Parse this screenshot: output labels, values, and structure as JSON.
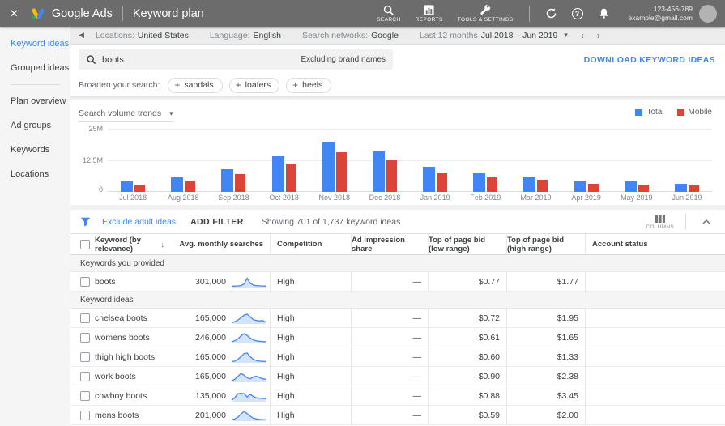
{
  "app_bar": {
    "product": "Google Ads",
    "page_title": "Keyword plan",
    "nav_items": [
      {
        "label": "SEARCH"
      },
      {
        "label": "REPORTS"
      },
      {
        "label": "TOOLS & SETTINGS"
      }
    ],
    "account_id": "123-456-789",
    "account_email": "example@gmail.com"
  },
  "sidebar": {
    "items": [
      {
        "label": "Keyword ideas"
      },
      {
        "label": "Grouped ideas"
      },
      {
        "label": "Plan overview"
      },
      {
        "label": "Ad groups"
      },
      {
        "label": "Keywords"
      },
      {
        "label": "Locations"
      }
    ]
  },
  "toolbar": {
    "filters": [
      {
        "label": "Locations:",
        "value": "United States"
      },
      {
        "label": "Language:",
        "value": "English"
      },
      {
        "label": "Search networks:",
        "value": "Google"
      }
    ],
    "date_label": "Last 12 months",
    "date_range": "Jul 2018 – Jun 2019"
  },
  "search": {
    "query": "boots",
    "brand_filter": "Excluding brand names",
    "download_label": "DOWNLOAD KEYWORD IDEAS"
  },
  "broaden": {
    "label": "Broaden your search:",
    "chips": [
      {
        "label": "sandals"
      },
      {
        "label": "loafers"
      },
      {
        "label": "heels"
      }
    ]
  },
  "chart_data": {
    "type": "bar",
    "title": "Search volume trends",
    "categories": [
      "Jul 2018",
      "Aug 2018",
      "Sep 2018",
      "Oct 2018",
      "Nov 2018",
      "Dec 2018",
      "Jan 2019",
      "Feb 2019",
      "Mar 2019",
      "Apr 2019",
      "May 2019",
      "Jun 2019"
    ],
    "series": [
      {
        "name": "Total",
        "color": "#4285f4",
        "values": [
          4.2,
          5.8,
          9.0,
          14.2,
          20.0,
          16.3,
          10.0,
          7.6,
          6.2,
          4.3,
          4.2,
          3.4
        ]
      },
      {
        "name": "Mobile",
        "color": "#db4437",
        "values": [
          3.0,
          4.4,
          7.0,
          11.0,
          15.8,
          12.7,
          7.7,
          5.8,
          4.8,
          3.1,
          2.8,
          2.6
        ]
      }
    ],
    "values_unit": "millions of searches",
    "ylim": [
      0,
      25
    ],
    "yticks": [
      "25M",
      "12.5M",
      "0"
    ],
    "grid": "horizontal",
    "legend_position": "top-right"
  },
  "filter_bar": {
    "exclude_link": "Exclude adult ideas",
    "add_filter": "ADD FILTER",
    "showing": "Showing 701 of 1,737 keyword ideas",
    "columns_label": "COLUMNS"
  },
  "table": {
    "columns": [
      "Keyword (by relevance)",
      "Avg. monthly searches",
      "Competition",
      "Ad impression share",
      "Top of page bid (low range)",
      "Top of page bid (high range)",
      "Account status"
    ],
    "sections": [
      {
        "label": "Keywords you provided",
        "rows": [
          {
            "keyword": "boots",
            "avg_monthly_searches": "301,000",
            "competition": "High",
            "ad_impression_share": "—",
            "top_bid_low": "$0.77",
            "top_bid_high": "$1.77",
            "account_status": "",
            "spark": [
              0.06,
              0.07,
              0.09,
              0.13,
              0.3,
              0.95,
              0.4,
              0.18,
              0.12,
              0.1,
              0.08,
              0.07
            ]
          }
        ]
      },
      {
        "label": "Keyword ideas",
        "rows": [
          {
            "keyword": "chelsea boots",
            "avg_monthly_searches": "165,000",
            "competition": "High",
            "ad_impression_share": "—",
            "top_bid_low": "$0.72",
            "top_bid_high": "$1.95",
            "account_status": "",
            "spark": [
              0.08,
              0.15,
              0.35,
              0.6,
              0.9,
              1.0,
              0.7,
              0.4,
              0.3,
              0.25,
              0.3,
              0.12
            ]
          },
          {
            "keyword": "womens boots",
            "avg_monthly_searches": "246,000",
            "competition": "High",
            "ad_impression_share": "—",
            "top_bid_low": "$0.61",
            "top_bid_high": "$1.65",
            "account_status": "",
            "spark": [
              0.1,
              0.2,
              0.4,
              0.75,
              1.0,
              0.8,
              0.5,
              0.3,
              0.2,
              0.15,
              0.12,
              0.1
            ]
          },
          {
            "keyword": "thigh high boots",
            "avg_monthly_searches": "165,000",
            "competition": "High",
            "ad_impression_share": "—",
            "top_bid_low": "$0.60",
            "top_bid_high": "$1.33",
            "account_status": "",
            "spark": [
              0.05,
              0.1,
              0.3,
              0.6,
              0.95,
              1.0,
              0.6,
              0.3,
              0.15,
              0.1,
              0.08,
              0.05
            ]
          },
          {
            "keyword": "work boots",
            "avg_monthly_searches": "165,000",
            "competition": "High",
            "ad_impression_share": "—",
            "top_bid_low": "$0.90",
            "top_bid_high": "$2.38",
            "account_status": "",
            "spark": [
              0.1,
              0.25,
              0.55,
              0.9,
              0.7,
              0.4,
              0.3,
              0.5,
              0.6,
              0.45,
              0.3,
              0.25
            ]
          },
          {
            "keyword": "cowboy boots",
            "avg_monthly_searches": "135,000",
            "competition": "High",
            "ad_impression_share": "—",
            "top_bid_low": "$0.88",
            "top_bid_high": "$3.45",
            "account_status": "",
            "spark": [
              0.1,
              0.35,
              0.8,
              0.85,
              0.8,
              0.45,
              0.75,
              0.5,
              0.35,
              0.3,
              0.28,
              0.25
            ]
          },
          {
            "keyword": "mens boots",
            "avg_monthly_searches": "201,000",
            "competition": "High",
            "ad_impression_share": "—",
            "top_bid_low": "$0.59",
            "top_bid_high": "$2.00",
            "account_status": "",
            "spark": [
              0.08,
              0.15,
              0.35,
              0.7,
              1.0,
              0.75,
              0.45,
              0.25,
              0.15,
              0.1,
              0.08,
              0.06
            ]
          }
        ]
      }
    ]
  },
  "icons": {
    "close": "✕",
    "collapse_left": "◀",
    "caret_down": "▾",
    "chevron_left": "‹",
    "chevron_right": "›",
    "sort_down": "↓",
    "plus": "+",
    "help": "?"
  }
}
